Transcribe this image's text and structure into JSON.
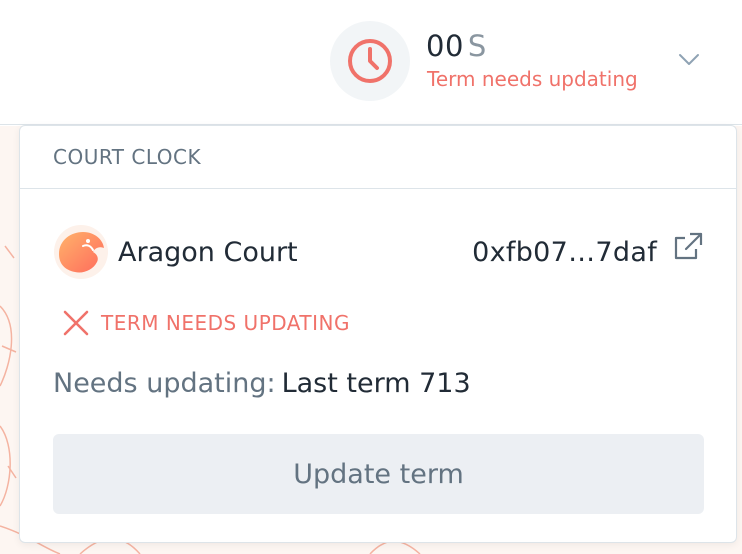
{
  "header": {
    "clock_value": "00",
    "clock_unit": "S",
    "clock_status": "Term needs updating"
  },
  "popover": {
    "title": "COURT CLOCK",
    "court_name": "Aragon Court",
    "court_address": "0xfb07…7daf",
    "status_text": "TERM NEEDS UPDATING",
    "needs_label": "Needs updating:",
    "needs_value": "Last term 713",
    "update_button_label": "Update term"
  },
  "icons": {
    "clock": "clock-icon",
    "chevron": "chevron-down-icon",
    "court_logo": "aragon-court-logo",
    "external_link": "external-link-icon",
    "status": "close-x-icon"
  },
  "colors": {
    "accent_red": "#f0726a",
    "text_dark": "#212b36",
    "text_muted": "#637381",
    "button_bg": "#eceff3",
    "border": "#dde4e9"
  }
}
